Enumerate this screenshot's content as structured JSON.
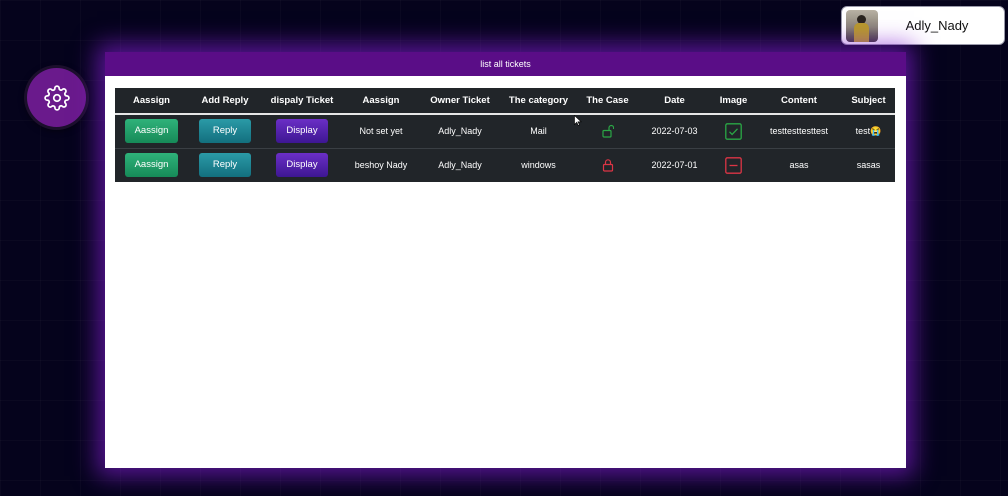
{
  "user": {
    "name": "Adly_Nady"
  },
  "panel": {
    "title": "list all tickets"
  },
  "table": {
    "headers": [
      "Aassign",
      "Add Reply",
      "dispaly Ticket",
      "Aassign",
      "Owner Ticket",
      "The category",
      "The Case",
      "Date",
      "Image",
      "Content",
      "Subject"
    ],
    "rows": [
      {
        "assign_label": "Aassign",
        "reply_label": "Reply",
        "display_label": "Display",
        "assignee": "Not set yet",
        "owner": "Adly_Nady",
        "category": "Mail",
        "case_icon": "unlock-icon",
        "case_color": "#2aa745",
        "date": "2022-07-03",
        "image_icon": "check-square-icon",
        "image_color": "#2aa745",
        "content": "testtesttesttest",
        "subject": "test😭"
      },
      {
        "assign_label": "Aassign",
        "reply_label": "Reply",
        "display_label": "Display",
        "assignee": "beshoy Nady",
        "owner": "Adly_Nady",
        "category": "windows",
        "case_icon": "lock-icon",
        "case_color": "#dc3545",
        "date": "2022-07-01",
        "image_icon": "minus-square-icon",
        "image_color": "#dc3545",
        "content": "asas",
        "subject": "sasas"
      }
    ]
  },
  "colors": {
    "panel_header": "#5a0d87",
    "settings_button": "#6a1a8c",
    "table_bg": "#212529"
  }
}
